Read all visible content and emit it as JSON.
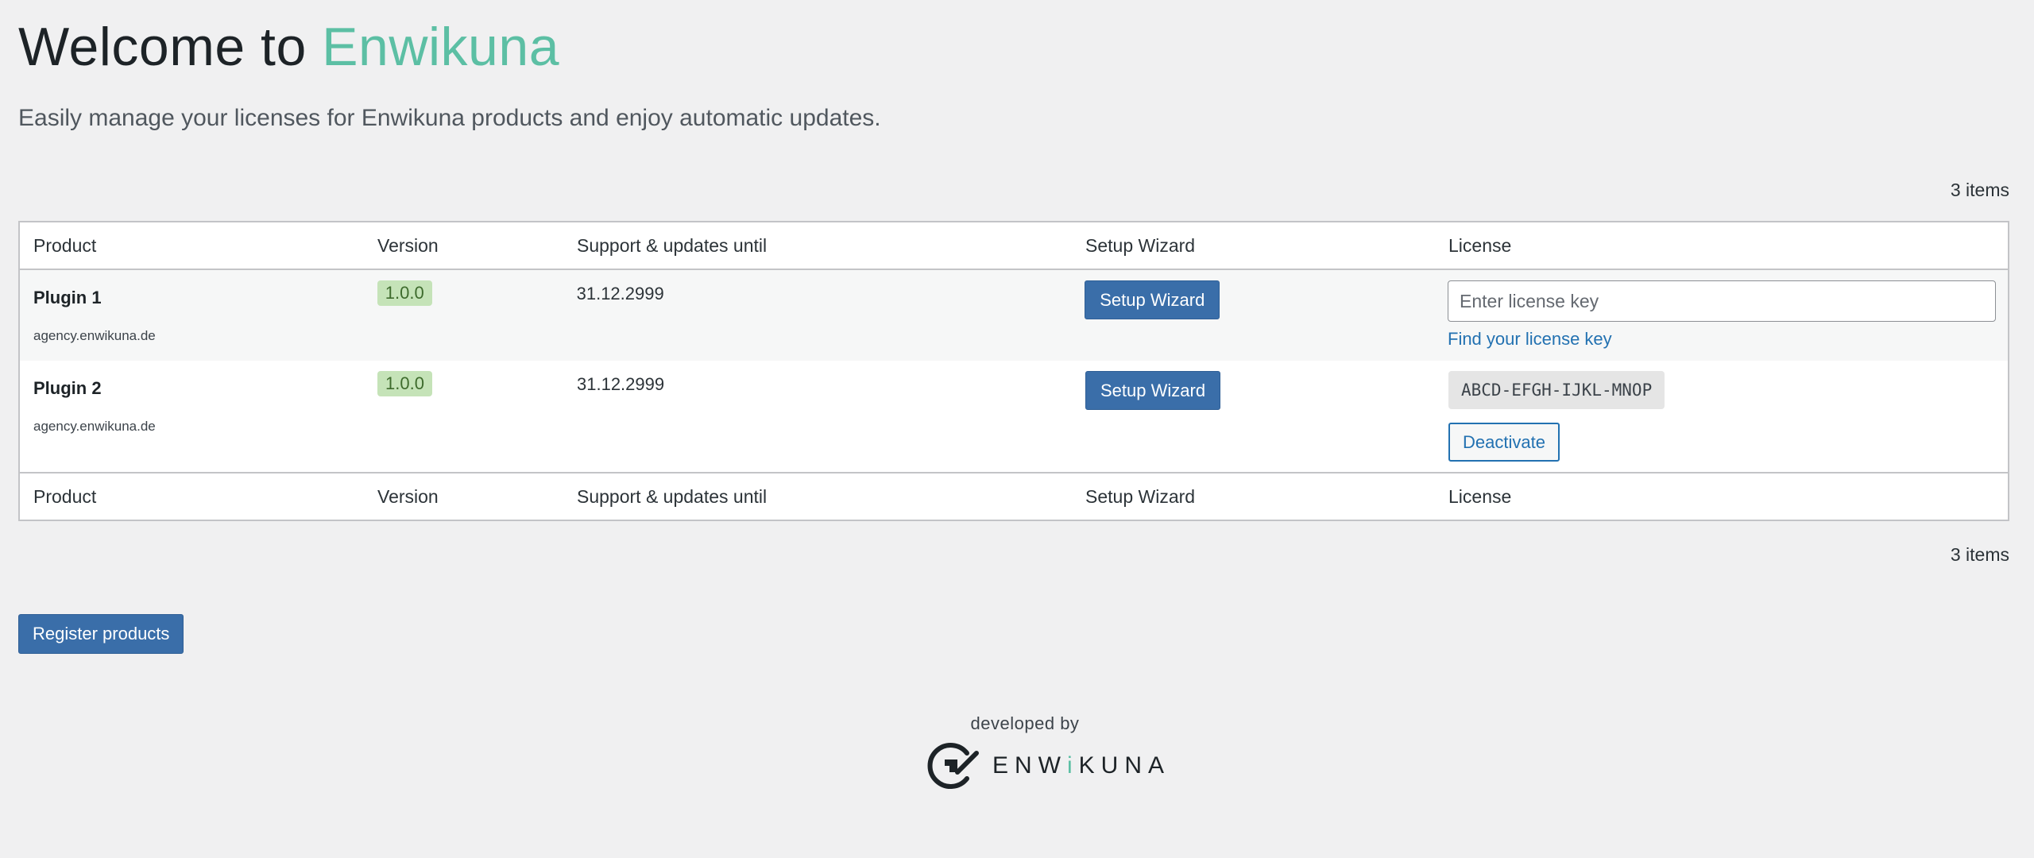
{
  "header": {
    "title_prefix": "Welcome to",
    "title_brand": "Enwikuna",
    "subtitle": "Easily manage your licenses for Enwikuna products and enjoy automatic updates."
  },
  "items_count": "3 items",
  "table": {
    "columns": [
      "Product",
      "Version",
      "Support & updates until",
      "Setup Wizard",
      "License"
    ],
    "rows": [
      {
        "product": "Plugin 1",
        "domain": "agency.enwikuna.de",
        "version": "1.0.0",
        "support_until": "31.12.2999",
        "setup_label": "Setup Wizard",
        "license_placeholder": "Enter license key",
        "license_link": "Find your license key"
      },
      {
        "product": "Plugin 2",
        "domain": "agency.enwikuna.de",
        "version": "1.0.0",
        "support_until": "31.12.2999",
        "setup_label": "Setup Wizard",
        "license_key": "ABCD-EFGH-IJKL-MNOP",
        "deactivate_label": "Deactivate"
      }
    ]
  },
  "register_label": "Register products",
  "footer": {
    "developed_by": "developed by",
    "logo_text_a": "ENW",
    "logo_text_k": "i",
    "logo_text_b": "KUNA"
  },
  "colors": {
    "brand": "#5cbfa4",
    "primary_button": "#3a6ea9",
    "link": "#2271b1",
    "version_badge": "#c5e3b8"
  }
}
